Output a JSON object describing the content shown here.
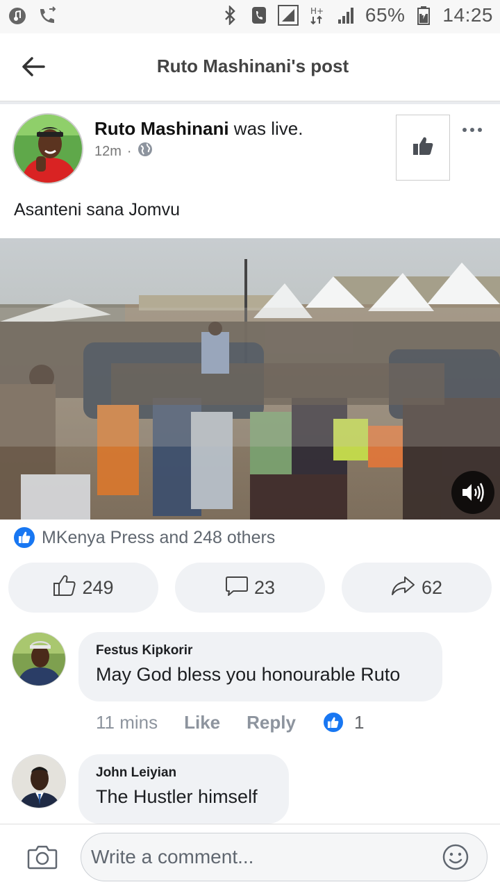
{
  "status_bar": {
    "battery": "65%",
    "time": "14:25",
    "icons": [
      "music-icon",
      "call-forward-icon",
      "bluetooth-icon",
      "vibrate-icon",
      "signal-icon",
      "hplus-icon",
      "signal-icon"
    ]
  },
  "header": {
    "title": "Ruto Mashinani's post",
    "back_icon": "back-arrow-icon"
  },
  "post": {
    "author": "Ruto Mashinani",
    "action": " was live.",
    "time": "12m",
    "separator": "·",
    "privacy_icon": "globe-icon",
    "text": "Asanteni sana Jomvu",
    "reactions_summary": "MKenya Press and 248 others",
    "like_count": "249",
    "comment_count": "23",
    "share_count": "62"
  },
  "comments": [
    {
      "name": "Festus Kipkorir",
      "text": "May God bless you honourable Ruto",
      "time": "11 mins",
      "like_label": "Like",
      "reply_label": "Reply",
      "reaction_count": "1"
    },
    {
      "name": "John Leiyian",
      "text": "The Hustler himself"
    }
  ],
  "composer": {
    "placeholder": "Write a comment..."
  },
  "colors": {
    "facebook_blue": "#1877f2",
    "bubble_gray": "#f0f2f5",
    "secondary_text": "#606770"
  }
}
